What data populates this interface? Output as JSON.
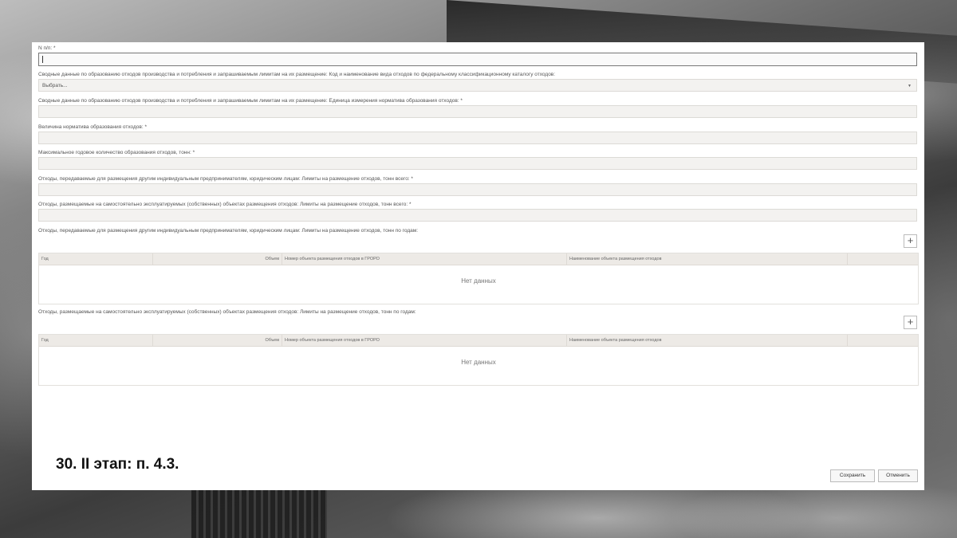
{
  "form": {
    "fields": [
      {
        "label": "N п/п: *",
        "type": "text-active"
      },
      {
        "label": "Сводные данные по образованию отходов производства и потребления и запрашиваемым лимитам на их размещение: Код и наименование вида отходов по федеральному классификационному каталогу отходов:",
        "type": "select",
        "value": "Выбрать..."
      },
      {
        "label": "Сводные данные по образованию отходов производства и потребления и запрашиваемым лимитам на их размещение: Единица измерения норматива образования отходов: *",
        "type": "text"
      },
      {
        "label": "Величина норматива образования отходов: *",
        "type": "text"
      },
      {
        "label": "Максимальное годовое количество образования отходов, тонн: *",
        "type": "text"
      },
      {
        "label": "Отходы, передаваемые для размещения другим индивидуальным предпринимателям, юридическим лицам: Лимиты на размещение отходов, тонн всего: *",
        "type": "text"
      },
      {
        "label": "Отходы, размещаемые на самостоятельно эксплуатируемых (собственных) объектах размещения отходов: Лимиты на размещение отходов, тонн всего: *",
        "type": "text"
      }
    ],
    "tables": [
      {
        "label": "Отходы, передаваемые для размещения другим индивидуальным предпринимателям, юридическим лицам: Лимиты на размещение отходов, тонн по годам:",
        "add": "+",
        "columns": [
          "Год",
          "Объем",
          "Номер объекта размещения отходов в ГРОРО",
          "Наименование объекта размещения отходов",
          ""
        ],
        "empty": "Нет данных"
      },
      {
        "label": "Отходы, размещаемые на самостоятельно эксплуатируемых (собственных) объектах размещения отходов: Лимиты на размещение отходов, тонн по годам:",
        "add": "+",
        "columns": [
          "Год",
          "Объем",
          "Номер объекта размещения отходов в ГРОРО",
          "Наименование объекта размещения отходов",
          ""
        ],
        "empty": "Нет данных"
      }
    ],
    "select_arrow": "▼",
    "buttons": {
      "save": "Сохранить",
      "cancel": "Отменить"
    }
  },
  "caption": "30. II этап: п. 4.3."
}
